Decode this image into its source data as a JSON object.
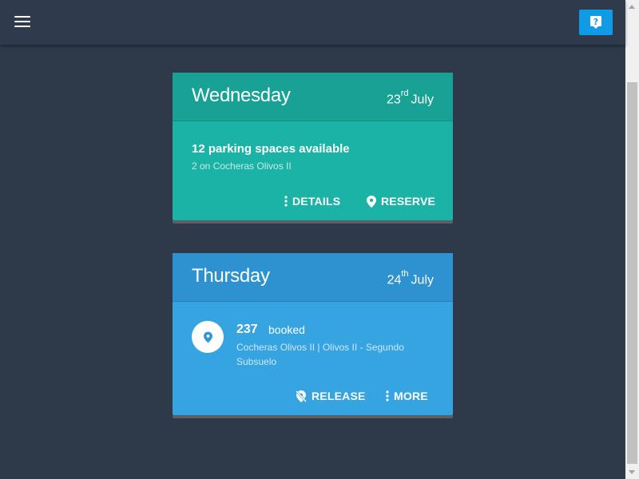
{
  "colors": {
    "background": "#2e3a4a",
    "topbar": "#2f3b4c",
    "help_button": "#0f9be6",
    "card_available": "#1ab3a6",
    "card_available_header": "#18a295",
    "card_booked": "#36a4e1",
    "card_booked_header": "#2d92cf"
  },
  "topbar": {
    "menu_icon": "hamburger-icon",
    "help_icon": "help-question-icon"
  },
  "cards": [
    {
      "day": "Wednesday",
      "date_day": "23",
      "date_suffix": "rd",
      "date_month": "July",
      "title": "12 parking spaces available",
      "subtitle": "2 on Cocheras Olivos II",
      "actions": [
        {
          "label": "DETAILS",
          "icon": "more-vertical-icon"
        },
        {
          "label": "RESERVE",
          "icon": "location-pin-icon"
        }
      ]
    },
    {
      "day": "Thursday",
      "date_day": "24",
      "date_suffix": "th",
      "date_month": "July",
      "spot_number": "237",
      "status": "booked",
      "location": "Cocheras Olivos II | Olivos II - Segundo Subsuelo",
      "actions": [
        {
          "label": "RELEASE",
          "icon": "location-off-icon"
        },
        {
          "label": "MORE",
          "icon": "more-vertical-icon"
        }
      ]
    }
  ]
}
